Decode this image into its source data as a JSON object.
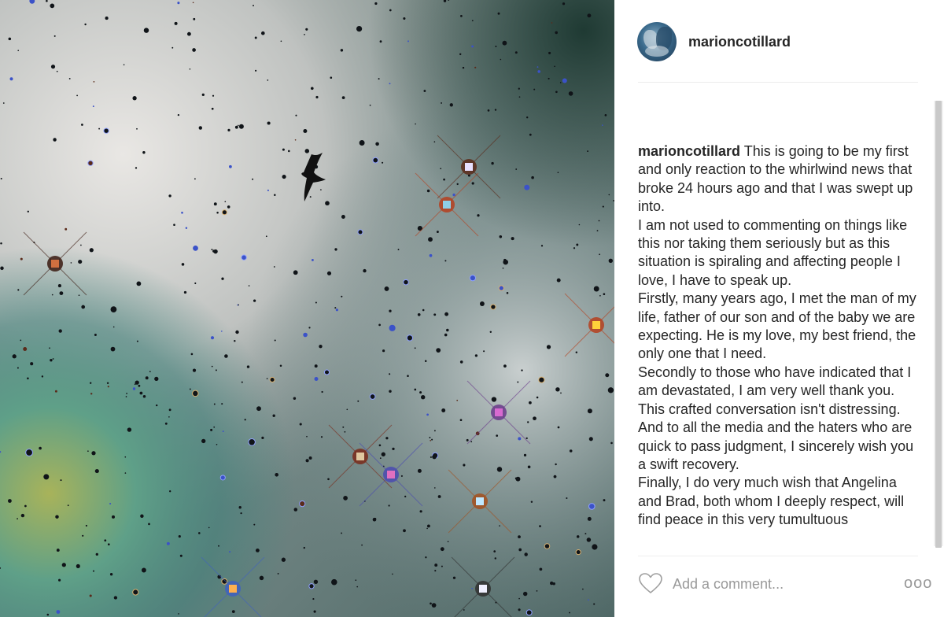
{
  "post": {
    "username": "marioncotillard",
    "caption": {
      "username": "marioncotillard",
      "first": "This is going to be my first and only reaction to the whirlwind news that broke 24 hours ago and that I was swept up into.",
      "paragraphs": [
        "I am not used to commenting on things like this nor taking them seriously but as this situation is spiraling and affecting people I love, I have to speak up.",
        "Firstly, many years ago, I met the man of my life, father of our son and of the baby we are expecting. He is my love, my best friend, the only one that I need.",
        "Secondly to those who have indicated that I am devastated, I am very well thank you. This crafted conversation isn't distressing.",
        "And to all the media and the haters who are quick to pass judgment, I sincerely wish you a swift recovery.",
        "Finally, I do very much wish that Angelina and Brad, both whom I deeply respect, will find peace in this very tumultuous"
      ]
    },
    "comment_placeholder": "Add a comment...",
    "more_label": "ooo"
  },
  "icons": {
    "like": "heart-icon",
    "more": "more-options-icon",
    "photo_subject": "bird-silhouette"
  },
  "colors": {
    "text": "#262626",
    "placeholder": "#999999",
    "divider": "#efefef"
  }
}
